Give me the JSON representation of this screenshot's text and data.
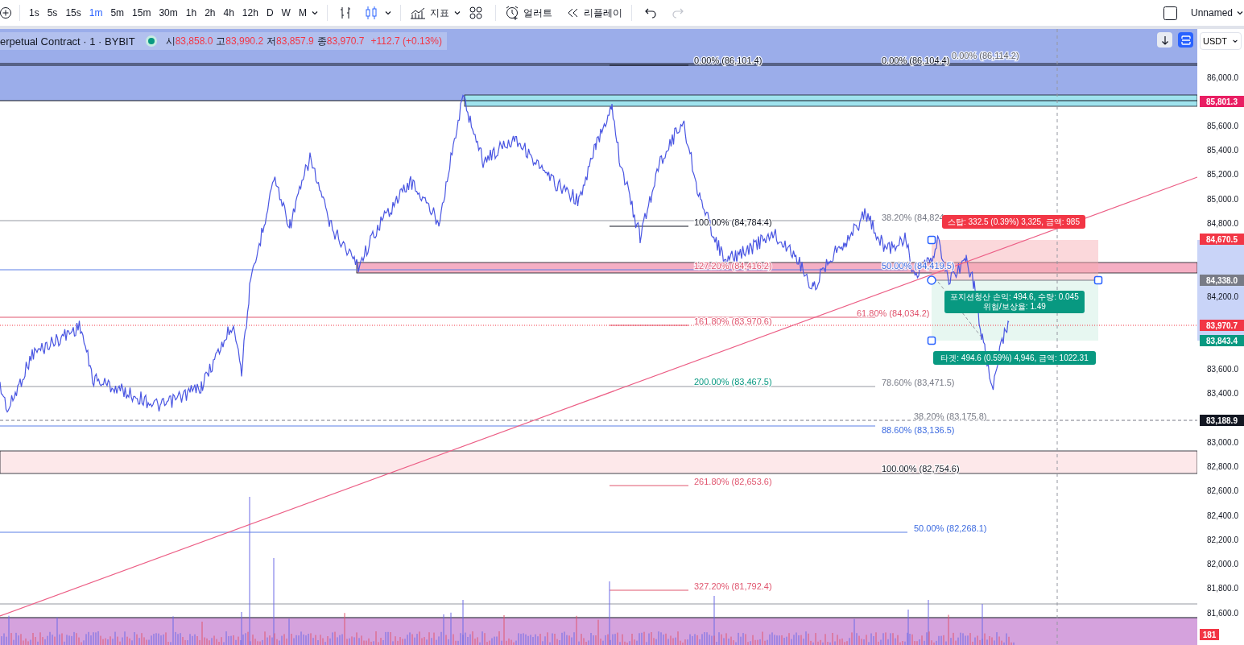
{
  "toolbar": {
    "intervals": [
      {
        "label": "1s",
        "selected": false
      },
      {
        "label": "5s",
        "selected": false
      },
      {
        "label": "15s",
        "selected": false
      },
      {
        "label": "1m",
        "selected": true
      },
      {
        "label": "5m",
        "selected": false
      },
      {
        "label": "15m",
        "selected": false
      },
      {
        "label": "30m",
        "selected": false
      },
      {
        "label": "1h",
        "selected": false
      },
      {
        "label": "2h",
        "selected": false
      },
      {
        "label": "4h",
        "selected": false
      },
      {
        "label": "12h",
        "selected": false
      },
      {
        "label": "D",
        "selected": false
      },
      {
        "label": "W",
        "selected": false
      },
      {
        "label": "M",
        "selected": false
      }
    ],
    "indicators": "지표",
    "alerts": "얼러트",
    "replay": "리플레이",
    "history": [
      {
        "kind": "undo",
        "disabled": false
      },
      {
        "kind": "redo",
        "disabled": true
      }
    ],
    "layout_name": "Unnamed"
  },
  "legend": {
    "symbol": "erpetual Contract · 1 · BYBIT",
    "values": [
      {
        "label": "시",
        "value": "83,858.0"
      },
      {
        "label": "고",
        "value": "83,990.2"
      },
      {
        "label": "저",
        "value": "83,857.9"
      },
      {
        "label": "종",
        "value": "83,970.7"
      }
    ],
    "change": "+112.7 (+0.13%)"
  },
  "currency": "USDT",
  "price_axis": {
    "ticks": [
      "86,000.0",
      "85,600.0",
      "85,400.0",
      "85,200.0",
      "85,000.0",
      "84,800.0",
      "84,200.0",
      "83,600.0",
      "83,400.0",
      "83,000.0",
      "82,800.0",
      "82,600.0",
      "82,400.0",
      "82,200.0",
      "82,000.0",
      "81,800.0",
      "81,600.0"
    ]
  },
  "price_badges": [
    {
      "text": "85,801.3",
      "color": "#e91e63"
    },
    {
      "text": "84,670.5",
      "color": "#f23645"
    },
    {
      "text": "84,338.0",
      "color": "#787b86"
    },
    {
      "text": "83,970.7",
      "color": "#f23645"
    },
    {
      "text": "83,843.4",
      "color": "#089981"
    },
    {
      "text": "83,188.9",
      "color": "#131722"
    },
    {
      "text": "181",
      "color": "#f23645"
    }
  ],
  "fib_labels": [
    {
      "text": "0.00% (86,101.4)",
      "color": "#131722"
    },
    {
      "text": "0.00% (86,104.4)",
      "color": "#131722"
    },
    {
      "text": "0.00% (86,114.2)",
      "color": "#5d606b"
    },
    {
      "text": "38.20% (84,824",
      "color": "#787b86"
    },
    {
      "text": "100.00% (84,784.4)",
      "color": "#131722"
    },
    {
      "text": "127.20% (84,416.2)",
      "color": "#e0566f"
    },
    {
      "text": "50.00% (84,419.5)",
      "color": "#3d6be0"
    },
    {
      "text": "61.80% (84,034.2)",
      "color": "#e0566f"
    },
    {
      "text": "161.80% (83,970.6)",
      "color": "#e0566f"
    },
    {
      "text": "200.00% (83,467.5)",
      "color": "#089981"
    },
    {
      "text": "78.60% (83,471.5)",
      "color": "#787b86"
    },
    {
      "text": "38.20% (83,175.8)",
      "color": "#787b86"
    },
    {
      "text": "88.60% (83,136.5)",
      "color": "#3d6be0"
    },
    {
      "text": "100.00% (82,754.6)",
      "color": "#131722"
    },
    {
      "text": "261.80% (82,653.6)",
      "color": "#e0566f"
    },
    {
      "text": "50.00% (82,268.1)",
      "color": "#3d6be0"
    },
    {
      "text": "327.20% (81,792.4)",
      "color": "#e0566f"
    }
  ],
  "position": {
    "stop_label": "스탑: 332.5 (0.39%) 3,325, 금액: 985",
    "pnl_label": "포지션청산 손익: 494.6, 수량: 0.045",
    "ratio_label": "위험/보상율: 1.49",
    "target_label": "타겟: 494.6 (0.59%) 4,946, 금액: 1022.31"
  }
}
